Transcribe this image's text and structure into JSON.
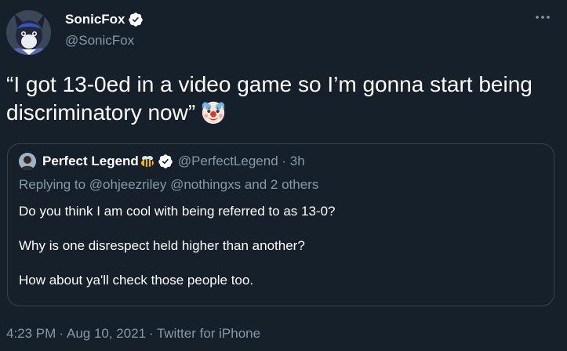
{
  "author": {
    "name": "SonicFox",
    "handle": "@SonicFox",
    "avatar_icon": "wolf-avatar-icon",
    "verified_icon": "verified-badge-icon"
  },
  "menu": {
    "more_icon": "more-options-icon"
  },
  "tweet": {
    "text": "“I got 13-0ed in a video game so I’m gonna start being discriminatory now”",
    "emoji": "clown-face-emoji"
  },
  "quoted_tweet": {
    "name": "Perfect Legend",
    "name_emoji": "bee-emoji",
    "handle": "@PerfectLegend",
    "separator": "·",
    "time": "3h",
    "replying_to_prefix": "Replying to",
    "replying_to_user1": "@ohjeezriley",
    "replying_to_user2": "@nothingxs",
    "replying_to_others": "and 2 others",
    "paragraphs": [
      "Do you think I am cool with being referred to as 13-0?",
      "Why is one disrespect held higher than another?",
      "How about ya'll check those people too."
    ]
  },
  "meta": {
    "time": "4:23 PM",
    "separator": "·",
    "date": "Aug 10, 2021",
    "client": "Twitter for iPhone"
  },
  "colors": {
    "background": "#15202b",
    "text_primary": "#ffffff",
    "text_secondary": "#8899a6",
    "border": "#38444d"
  }
}
